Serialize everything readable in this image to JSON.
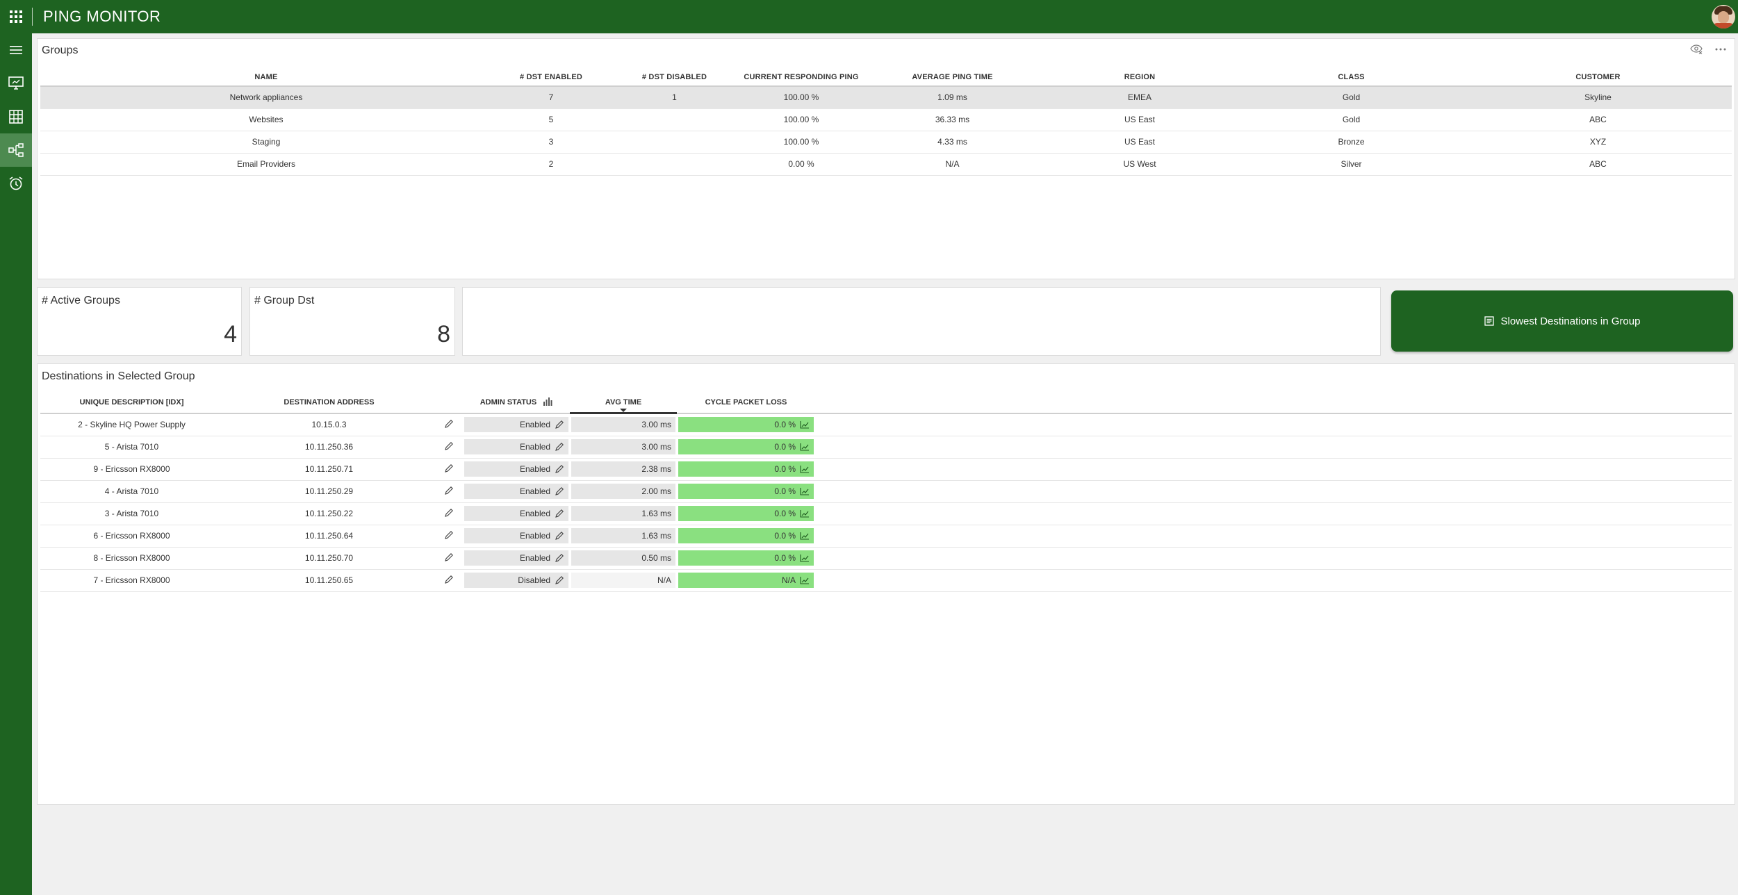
{
  "app": {
    "title": "PING MONITOR"
  },
  "sidebar": {
    "items": [
      {
        "icon": "menu-icon"
      },
      {
        "icon": "monitor-icon"
      },
      {
        "icon": "table-icon"
      },
      {
        "icon": "hierarchy-icon"
      },
      {
        "icon": "alarm-clock-icon"
      }
    ]
  },
  "groups": {
    "title": "Groups",
    "columns": [
      "NAME",
      "# DST ENABLED",
      "# DST DISABLED",
      "CURRENT RESPONDING PING",
      "AVERAGE PING TIME",
      "REGION",
      "CLASS",
      "CUSTOMER"
    ],
    "rows": [
      {
        "name": "Network appliances",
        "enabled": "7",
        "disabled": "1",
        "responding": "100.00 %",
        "avg": "1.09 ms",
        "region": "EMEA",
        "class": "Gold",
        "customer": "Skyline"
      },
      {
        "name": "Websites",
        "enabled": "5",
        "disabled": "",
        "responding": "100.00 %",
        "avg": "36.33 ms",
        "region": "US East",
        "class": "Gold",
        "customer": "ABC"
      },
      {
        "name": "Staging",
        "enabled": "3",
        "disabled": "",
        "responding": "100.00 %",
        "avg": "4.33 ms",
        "region": "US East",
        "class": "Bronze",
        "customer": "XYZ"
      },
      {
        "name": "Email Providers",
        "enabled": "2",
        "disabled": "",
        "responding": "0.00 %",
        "avg": "N/A",
        "region": "US West",
        "class": "Silver",
        "customer": "ABC"
      }
    ]
  },
  "kpis": {
    "active_groups": {
      "label": "# Active Groups",
      "value": "4"
    },
    "group_dst": {
      "label": "# Group Dst",
      "value": "8"
    }
  },
  "slowest_button": {
    "label": "Slowest Destinations in Group"
  },
  "destinations": {
    "title": "Destinations in Selected Group",
    "columns": [
      "UNIQUE DESCRIPTION [IDX]",
      "DESTINATION ADDRESS",
      "ADMIN STATUS",
      "AVG TIME",
      "CYCLE PACKET LOSS"
    ],
    "rows": [
      {
        "desc": "2 - Skyline HQ Power Supply",
        "address": "10.15.0.3",
        "status": "Enabled",
        "avg": "3.00 ms",
        "loss": "0.0 %"
      },
      {
        "desc": "5 - Arista 7010",
        "address": "10.11.250.36",
        "status": "Enabled",
        "avg": "3.00 ms",
        "loss": "0.0 %"
      },
      {
        "desc": "9 - Ericsson RX8000",
        "address": "10.11.250.71",
        "status": "Enabled",
        "avg": "2.38 ms",
        "loss": "0.0 %"
      },
      {
        "desc": "4 - Arista 7010",
        "address": "10.11.250.29",
        "status": "Enabled",
        "avg": "2.00 ms",
        "loss": "0.0 %"
      },
      {
        "desc": "3 - Arista 7010",
        "address": "10.11.250.22",
        "status": "Enabled",
        "avg": "1.63 ms",
        "loss": "0.0 %"
      },
      {
        "desc": "6 - Ericsson RX8000",
        "address": "10.11.250.64",
        "status": "Enabled",
        "avg": "1.63 ms",
        "loss": "0.0 %"
      },
      {
        "desc": "8 - Ericsson RX8000",
        "address": "10.11.250.70",
        "status": "Enabled",
        "avg": "0.50 ms",
        "loss": "0.0 %"
      },
      {
        "desc": "7 - Ericsson RX8000",
        "address": "10.11.250.65",
        "status": "Disabled",
        "avg": "N/A",
        "loss": "N/A"
      }
    ]
  },
  "colors": {
    "brand": "#1e6321",
    "sidebar_active": "#4d8a50",
    "loss_ok": "#8ae080",
    "selected_row": "#e5e5e5"
  }
}
